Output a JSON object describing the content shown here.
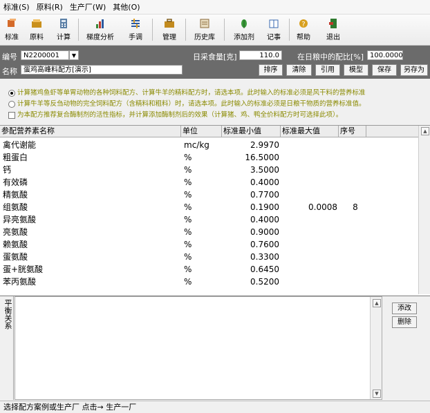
{
  "menu": [
    "标准(S)",
    "原料(R)",
    "生产厂(W)",
    "其他(O)"
  ],
  "toolbar": [
    {
      "label": "标准",
      "icon": "standard-icon",
      "color": "#d46a2a"
    },
    {
      "label": "原料",
      "icon": "ingredient-icon",
      "color": "#c9901c"
    },
    {
      "label": "计算",
      "icon": "calculator-icon",
      "color": "#5b7fa6"
    },
    {
      "label": "梯度分析",
      "icon": "bar-chart-icon",
      "color": "#3a8a3a"
    },
    {
      "label": "手调",
      "icon": "adjust-icon",
      "color": "#2c5aa0"
    },
    {
      "label": "管理",
      "icon": "briefcase-icon",
      "color": "#c28a1e"
    },
    {
      "label": "历史库",
      "icon": "history-icon",
      "color": "#8a6a3a"
    },
    {
      "label": "添加剂",
      "icon": "leaf-icon",
      "color": "#3a9a3a"
    },
    {
      "label": "记事",
      "icon": "notebook-icon",
      "color": "#3a6ab0"
    },
    {
      "label": "帮助",
      "icon": "help-icon",
      "color": "#d8a020"
    },
    {
      "label": "退出",
      "icon": "exit-icon",
      "color": "#2f7a2f"
    }
  ],
  "info": {
    "code_label": "编号",
    "code_value": "N2200001",
    "name_label": "名称",
    "name_value": "蛋鸡高峰料配方[演示]",
    "intake_label": "日采食量[克]",
    "intake_value": "110.0",
    "ratio_label": "在日粮中的配比[%]",
    "ratio_value": "100.0000",
    "buttons": [
      "排序",
      "清除",
      "引用",
      "模型",
      "保存",
      "另存为"
    ]
  },
  "options": [
    {
      "type": "radio",
      "checked": true,
      "text": "计算猪鸡鱼虾等单胃动物的各种饲料配方、计算牛羊的精料配方时，请选本项。此时输入的标准必须是风干料的营养标准"
    },
    {
      "type": "radio",
      "checked": false,
      "text": "计算牛羊等反刍动物的完全饲料配方（含精料和粗料）时，请选本项。此时输入的标准必须是日粮干物质的营养标准值。"
    },
    {
      "type": "checkbox",
      "checked": false,
      "text": "为本配方推荐复合酶制剂的活性指标，并计算添加酶制剂后的效果（计算猪、鸡、鸭全价料配方时可选择此项）。"
    }
  ],
  "grid": {
    "headers": [
      "参配营养素名称",
      "单位",
      "标准最小值",
      "标准最大值",
      "序号"
    ],
    "rows": [
      {
        "name": "禽代谢能",
        "unit": "mc/kg",
        "min": "2.9970",
        "max": "",
        "seq": ""
      },
      {
        "name": "粗蛋白",
        "unit": "%",
        "min": "16.5000",
        "max": "",
        "seq": ""
      },
      {
        "name": "钙",
        "unit": "%",
        "min": "3.5000",
        "max": "",
        "seq": ""
      },
      {
        "name": "有效磷",
        "unit": "%",
        "min": "0.4000",
        "max": "",
        "seq": ""
      },
      {
        "name": "精氨酸",
        "unit": "%",
        "min": "0.7700",
        "max": "",
        "seq": ""
      },
      {
        "name": "组氨酸",
        "unit": "%",
        "min": "0.1900",
        "max": "0.0008",
        "seq": "8"
      },
      {
        "name": "异亮氨酸",
        "unit": "%",
        "min": "0.4000",
        "max": "",
        "seq": ""
      },
      {
        "name": "亮氨酸",
        "unit": "%",
        "min": "0.9000",
        "max": "",
        "seq": ""
      },
      {
        "name": "赖氨酸",
        "unit": "%",
        "min": "0.7600",
        "max": "",
        "seq": ""
      },
      {
        "name": "蛋氨酸",
        "unit": "%",
        "min": "0.3300",
        "max": "",
        "seq": ""
      },
      {
        "name": "蛋+胱氨酸",
        "unit": "%",
        "min": "0.6450",
        "max": "",
        "seq": ""
      },
      {
        "name": "苯丙氨酸",
        "unit": "%",
        "min": "0.5200",
        "max": "",
        "seq": ""
      }
    ]
  },
  "lower": {
    "side_label": "平衡关系",
    "edit_button": "添改",
    "delete_button": "删除"
  },
  "status": "选择配方案例或生产厂  点击→  生产一厂"
}
